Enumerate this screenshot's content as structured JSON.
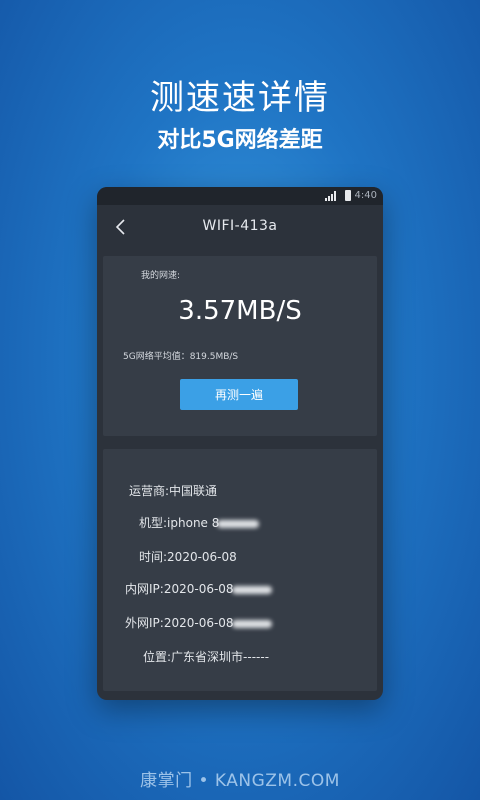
{
  "promo": {
    "headline": "测速速详情",
    "subline": "对比5G网络差距"
  },
  "status_bar": {
    "time": "4:40",
    "icons": [
      "signal-icon",
      "battery-icon"
    ]
  },
  "nav": {
    "title": "WIFI-413a",
    "back_icon": "chevron-left-icon"
  },
  "speed": {
    "label": "我的网速:",
    "value": "3.57MB/S",
    "average_label": "5G网络平均值：819.5MB/S",
    "retest_button": "再测一遍"
  },
  "info": {
    "carrier": "运营商:中国联通",
    "model": "机型:iphone 8",
    "time": "时间:2020-06-08",
    "lan_ip": "内网IP:2020-06-08",
    "wan_ip": "外网IP:2020-06-08",
    "location": "位置:广东省深圳市------"
  },
  "watermark": "康掌门 • KANGZM.COM",
  "colors": {
    "accent": "#3ba0e6",
    "card": "#363d47",
    "screen": "#2c323b"
  }
}
